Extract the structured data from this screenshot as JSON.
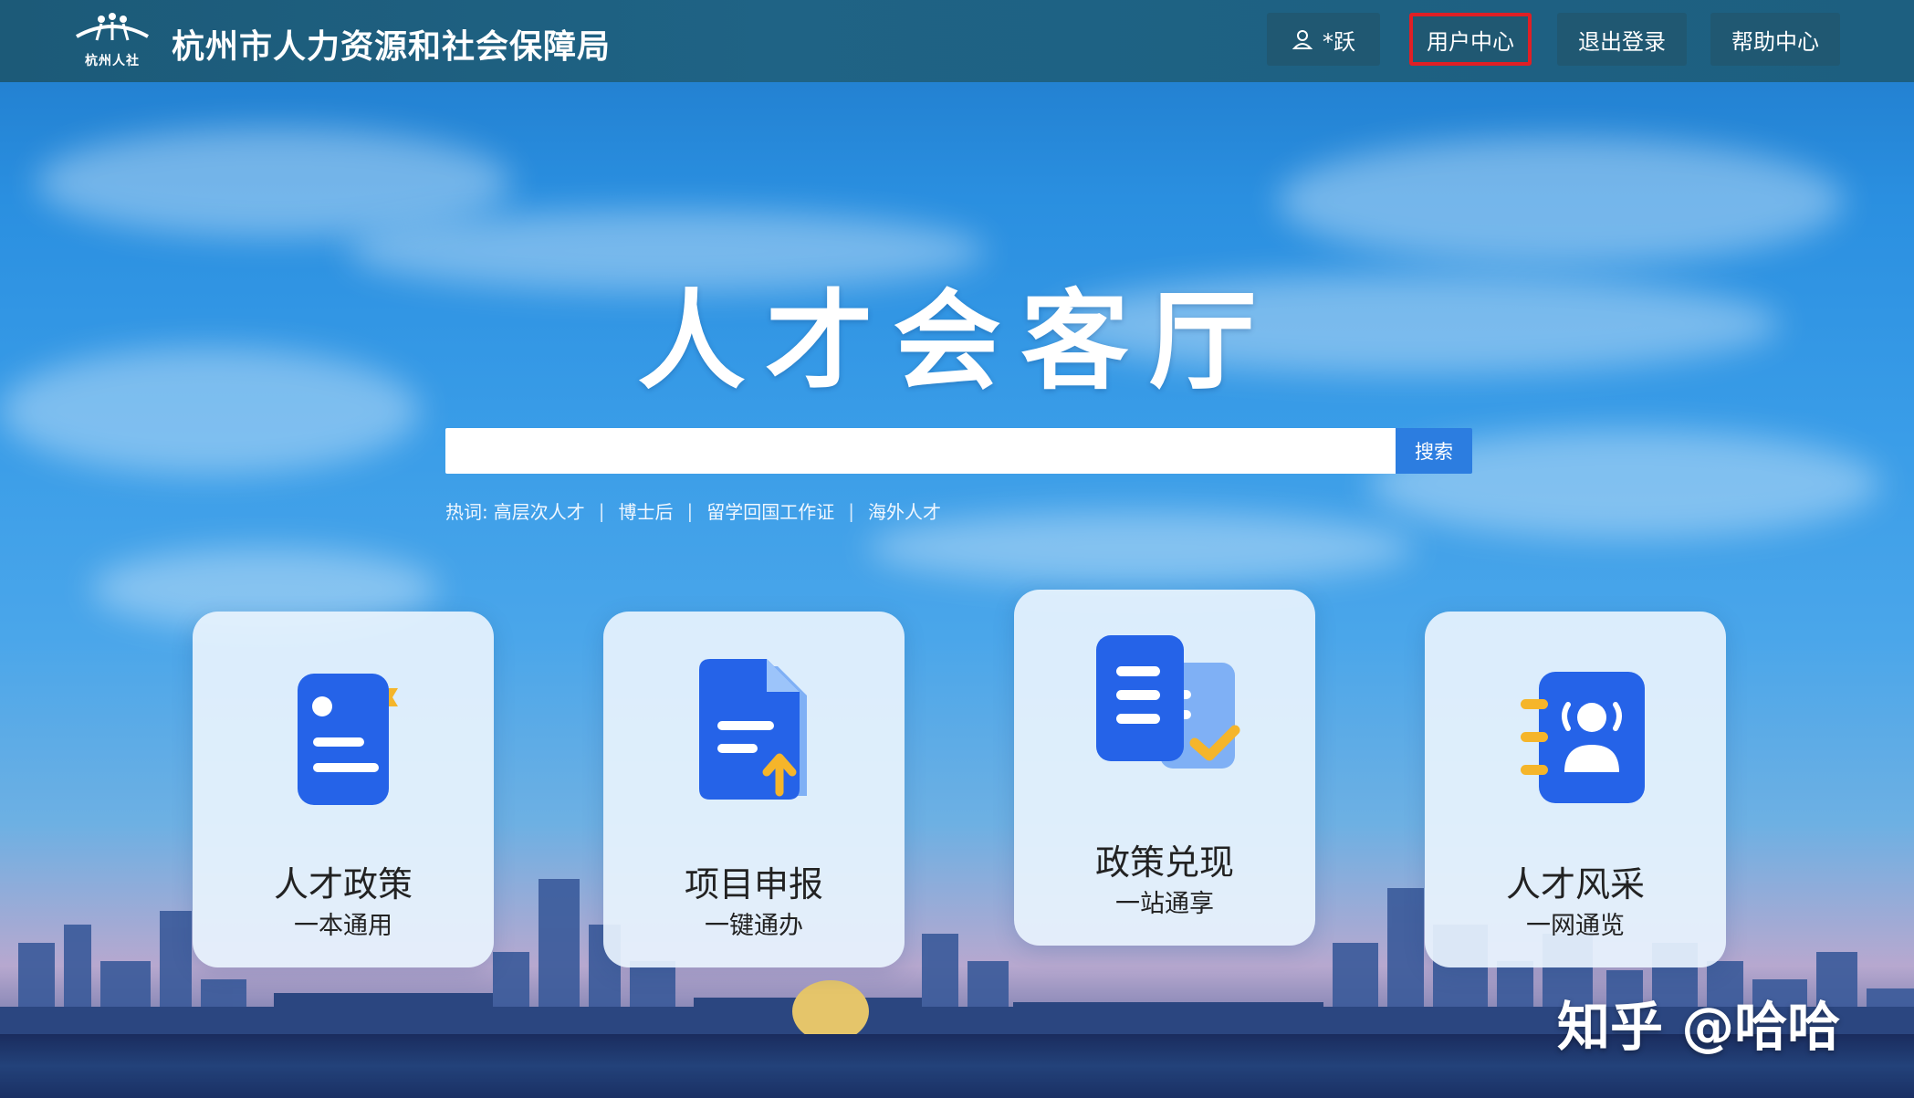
{
  "header": {
    "logo_text": "杭州人社",
    "site_title": "杭州市人力资源和社会保障局",
    "nav": {
      "user_label": "*跃",
      "user_center": "用户中心",
      "logout": "退出登录",
      "help": "帮助中心"
    }
  },
  "hero": {
    "title": "人才会客厅"
  },
  "search": {
    "placeholder": "",
    "value": "",
    "button": "搜索"
  },
  "hotwords": {
    "label": "热词:",
    "items": [
      "高层次人才",
      "博士后",
      "留学回国工作证",
      "海外人才"
    ],
    "separator": "|"
  },
  "cards": [
    {
      "title": "人才政策",
      "subtitle": "一本通用",
      "icon": "document-profile-icon"
    },
    {
      "title": "项目申报",
      "subtitle": "一键通办",
      "icon": "file-upload-icon"
    },
    {
      "title": "政策兑现",
      "subtitle": "一站通享",
      "icon": "policy-check-icon"
    },
    {
      "title": "人才风采",
      "subtitle": "一网通览",
      "icon": "talent-profile-icon"
    }
  ],
  "watermark": "知乎 @哈哈",
  "colors": {
    "header_bg": "#1f6385",
    "nav_btn_bg": "#205872",
    "active_outline": "#e01f25",
    "search_btn": "#2c7de0",
    "icon_blue": "#2563e8",
    "icon_accent": "#f5b52a"
  }
}
